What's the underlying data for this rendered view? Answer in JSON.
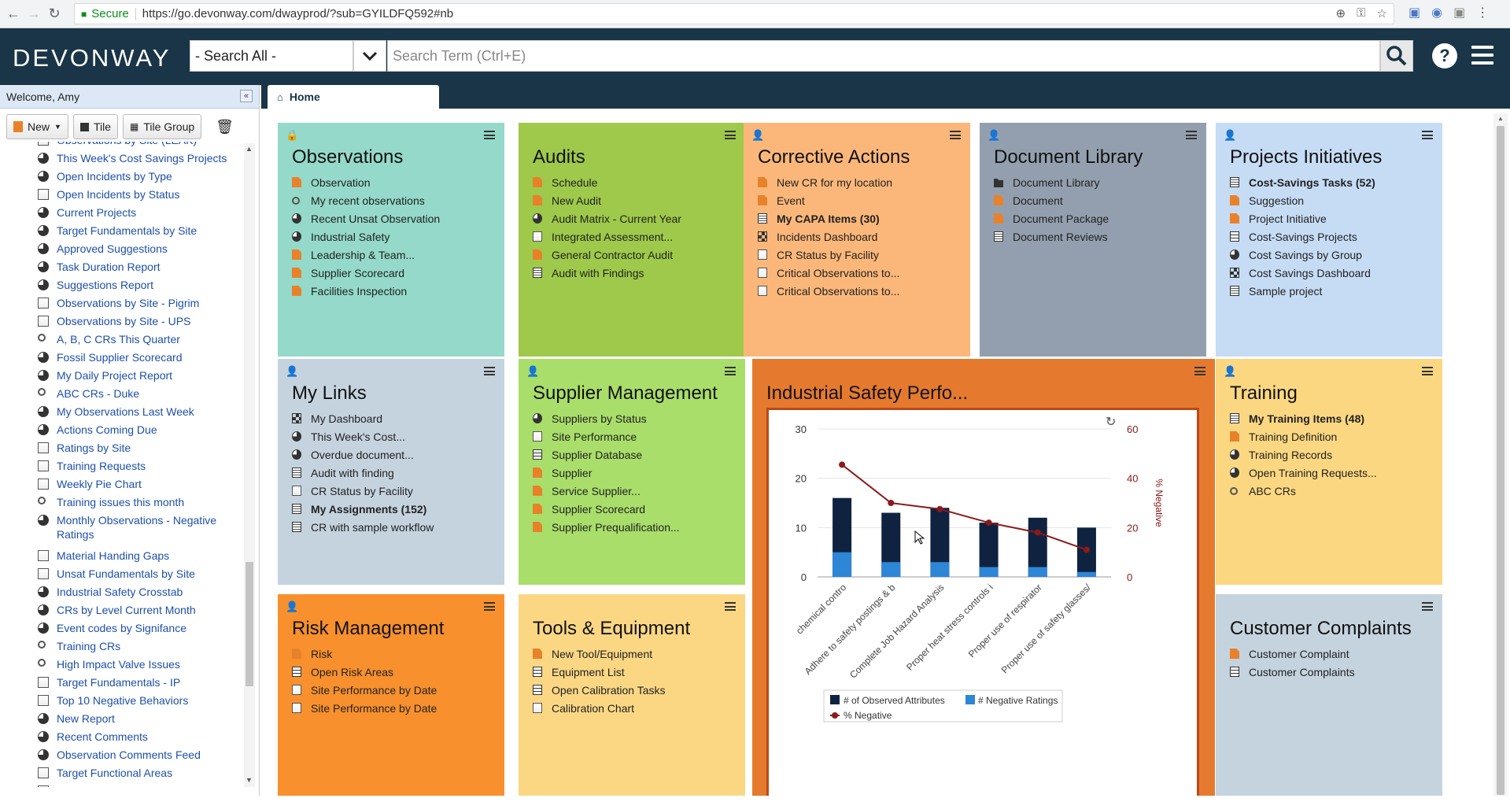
{
  "browser": {
    "secure_label": "Secure",
    "url": "https://go.devonway.com/dwayprod/?sub=GYILDFQ592#nb"
  },
  "header": {
    "logo": "DEVONWAY",
    "search_scope": "- Search All -",
    "search_placeholder": "Search Term (Ctrl+E)",
    "help": "?"
  },
  "sidebar": {
    "welcome": "Welcome, Amy",
    "tools": {
      "new": "New",
      "tile": "Tile",
      "tile_group": "Tile Group"
    },
    "items": [
      {
        "label": "Observations by Site (LEAK)",
        "icon": "chart"
      },
      {
        "label": "This Week's Cost Savings Projects",
        "icon": "pie"
      },
      {
        "label": "Open Incidents by Type",
        "icon": "pie"
      },
      {
        "label": "Open Incidents by Status",
        "icon": "chart"
      },
      {
        "label": "Current Projects",
        "icon": "pie"
      },
      {
        "label": "Target Fundamentals by Site",
        "icon": "pie"
      },
      {
        "label": "Approved Suggestions",
        "icon": "pie"
      },
      {
        "label": "Task Duration Report",
        "icon": "pie"
      },
      {
        "label": "Suggestions Report",
        "icon": "pie"
      },
      {
        "label": "Observations by Site - Pigrim",
        "icon": "chart"
      },
      {
        "label": "Observations by Site - UPS",
        "icon": "chart"
      },
      {
        "label": "A, B, C CRs This Quarter",
        "icon": "search"
      },
      {
        "label": "Fossil Supplier Scorecard",
        "icon": "pie"
      },
      {
        "label": "My Daily Project Report",
        "icon": "pie"
      },
      {
        "label": "ABC CRs - Duke",
        "icon": "search"
      },
      {
        "label": "My Observations Last Week",
        "icon": "pie"
      },
      {
        "label": "Actions Coming Due",
        "icon": "pie"
      },
      {
        "label": "Ratings by Site",
        "icon": "chart"
      },
      {
        "label": "Training Requests",
        "icon": "chart"
      },
      {
        "label": "Weekly Pie Chart",
        "icon": "chart"
      },
      {
        "label": "Training issues this month",
        "icon": "search"
      },
      {
        "label": "Monthly Observations - Negative Ratings",
        "icon": "pie",
        "tall": true
      },
      {
        "label": "Material Handing Gaps",
        "icon": "chart"
      },
      {
        "label": "Unsat Fundamentals by Site",
        "icon": "chart"
      },
      {
        "label": "Industrial Safety Crosstab",
        "icon": "pie"
      },
      {
        "label": "CRs by Level Current Month",
        "icon": "pie"
      },
      {
        "label": "Event codes by Signifance",
        "icon": "pie"
      },
      {
        "label": "Training CRs",
        "icon": "search"
      },
      {
        "label": "High Impact Valve Issues",
        "icon": "search"
      },
      {
        "label": "Target Fundamentals - IP",
        "icon": "chart"
      },
      {
        "label": "Top 10 Negative Behaviors",
        "icon": "chart"
      },
      {
        "label": "New Report",
        "icon": "pie"
      },
      {
        "label": "Recent Comments",
        "icon": "pie"
      },
      {
        "label": "Observation Comments Feed",
        "icon": "pie"
      },
      {
        "label": "Target Functional Areas",
        "icon": "chart"
      },
      {
        "label": "Upcoming Audits",
        "icon": "chart"
      }
    ]
  },
  "tabs": {
    "home": "Home"
  },
  "tiles": {
    "observations": {
      "title": "Observations",
      "color": "#94d9c9",
      "links": [
        {
          "label": "Observation",
          "icon": "doc"
        },
        {
          "label": "My recent observations",
          "icon": "search"
        },
        {
          "label": "Recent Unsat Observation",
          "icon": "pie"
        },
        {
          "label": "Industrial Safety",
          "icon": "pie"
        },
        {
          "label": "Leadership & Team...",
          "icon": "doc"
        },
        {
          "label": "Supplier Scorecard",
          "icon": "doc"
        },
        {
          "label": "Facilities Inspection",
          "icon": "doc"
        }
      ]
    },
    "audits": {
      "title": "Audits",
      "color": "#9ec94a",
      "links": [
        {
          "label": "Schedule",
          "icon": "doc"
        },
        {
          "label": "New Audit",
          "icon": "doc"
        },
        {
          "label": "Audit Matrix - Current Year",
          "icon": "pie"
        },
        {
          "label": "Integrated Assessment...",
          "icon": "chart"
        },
        {
          "label": "General Contractor Audit",
          "icon": "doc"
        },
        {
          "label": "Audit with Findings",
          "icon": "list"
        }
      ]
    },
    "corrective": {
      "title": "Corrective Actions",
      "color": "#fbb77a",
      "links": [
        {
          "label": "New CR for my location",
          "icon": "doc"
        },
        {
          "label": "Event",
          "icon": "doc"
        },
        {
          "label": "My CAPA Items (30)",
          "icon": "list",
          "bold": true
        },
        {
          "label": "Incidents Dashboard",
          "icon": "dash"
        },
        {
          "label": "CR Status by Facility",
          "icon": "chart"
        },
        {
          "label": "Critical Observations to...",
          "icon": "chart"
        },
        {
          "label": "Critical Observations to...",
          "icon": "chart"
        }
      ]
    },
    "doclib": {
      "title": "Document Library",
      "color": "#939fae",
      "links": [
        {
          "label": "Document Library",
          "icon": "folder"
        },
        {
          "label": "Document",
          "icon": "doc"
        },
        {
          "label": "Document Package",
          "icon": "doc"
        },
        {
          "label": "Document Reviews",
          "icon": "list"
        }
      ]
    },
    "projects": {
      "title": "Projects Initiatives",
      "color": "#c6dcf5",
      "links": [
        {
          "label": "Cost-Savings Tasks (52)",
          "icon": "list",
          "bold": true
        },
        {
          "label": "Suggestion",
          "icon": "doc"
        },
        {
          "label": "Project Initiative",
          "icon": "doc"
        },
        {
          "label": "Cost-Savings Projects",
          "icon": "grid"
        },
        {
          "label": "Cost Savings by Group",
          "icon": "pie"
        },
        {
          "label": "Cost Savings Dashboard",
          "icon": "dash"
        },
        {
          "label": "Sample project",
          "icon": "list"
        }
      ]
    },
    "mylinks": {
      "title": "My Links",
      "color": "#c5d3df",
      "links": [
        {
          "label": "My Dashboard",
          "icon": "dash"
        },
        {
          "label": "This Week's Cost...",
          "icon": "pie"
        },
        {
          "label": "Overdue document...",
          "icon": "pie"
        },
        {
          "label": "Audit with finding",
          "icon": "list"
        },
        {
          "label": "CR Status by Facility",
          "icon": "chart"
        },
        {
          "label": "My Assignments (152)",
          "icon": "list",
          "bold": true
        },
        {
          "label": "CR with sample workflow",
          "icon": "list"
        }
      ]
    },
    "supplier": {
      "title": "Supplier Management",
      "color": "#a9de6a",
      "links": [
        {
          "label": "Suppliers by Status",
          "icon": "pie"
        },
        {
          "label": "Site Performance",
          "icon": "chart"
        },
        {
          "label": "Supplier Database",
          "icon": "grid"
        },
        {
          "label": "Supplier",
          "icon": "doc"
        },
        {
          "label": "Service Supplier...",
          "icon": "doc"
        },
        {
          "label": "Supplier Scorecard",
          "icon": "doc"
        },
        {
          "label": "Supplier Prequalification...",
          "icon": "doc"
        }
      ]
    },
    "training": {
      "title": "Training",
      "color": "#fcd781",
      "links": [
        {
          "label": "My Training Items (48)",
          "icon": "list",
          "bold": true
        },
        {
          "label": "Training Definition",
          "icon": "doc"
        },
        {
          "label": "Training Records",
          "icon": "pie"
        },
        {
          "label": "Open Training Requests...",
          "icon": "pie"
        },
        {
          "label": "ABC CRs",
          "icon": "search"
        }
      ]
    },
    "risk": {
      "title": "Risk Management",
      "color": "#f7902d",
      "links": [
        {
          "label": "Risk",
          "icon": "doc"
        },
        {
          "label": "Open Risk Areas",
          "icon": "grid"
        },
        {
          "label": "Site Performance by Date",
          "icon": "chart"
        },
        {
          "label": "Site Performance by Date",
          "icon": "chart"
        }
      ]
    },
    "tools": {
      "title": "Tools & Equipment",
      "color": "#fbd784",
      "links": [
        {
          "label": "New Tool/Equipment",
          "icon": "doc"
        },
        {
          "label": "Equipment List",
          "icon": "grid"
        },
        {
          "label": "Open Calibration Tasks",
          "icon": "grid"
        },
        {
          "label": "Calibration Chart",
          "icon": "chart"
        }
      ]
    },
    "complaints": {
      "title": "Customer Complaints",
      "color": "#c5d3df",
      "links": [
        {
          "label": "Customer Complaint",
          "icon": "doc"
        },
        {
          "label": "Customer Complaints",
          "icon": "grid"
        }
      ]
    }
  },
  "chart_tile": {
    "title": "Industrial Safety Perfo...",
    "color": "#e57a2e"
  },
  "chart_data": {
    "type": "bar",
    "categories": [
      "chemical contro",
      "Adhere to safety postings & b",
      "Complete Job Hazard Analysis",
      "Proper heat stress controls i",
      "Proper use of respirator",
      "Proper use of safety glasses/"
    ],
    "series": [
      {
        "name": "# of Observed Attributes",
        "type": "bar-stacked",
        "color": "#0f2340",
        "values": [
          11,
          10,
          11,
          9,
          10,
          9
        ]
      },
      {
        "name": "# Negative Ratings",
        "type": "bar-stacked",
        "color": "#2e86d6",
        "values": [
          5,
          3,
          3,
          2,
          2,
          1
        ]
      },
      {
        "name": "% Negative",
        "type": "line",
        "axis": "right",
        "color": "#8b1a1a",
        "values": [
          45.5,
          30,
          27.5,
          22,
          18,
          11
        ]
      }
    ],
    "ylim": [
      0,
      30
    ],
    "yticks": [
      "0",
      "10",
      "20",
      "30"
    ],
    "y2lim": [
      0,
      60
    ],
    "y2ticks": [
      "0",
      "20",
      "40",
      "60"
    ],
    "y2label": "% Negative",
    "legend_position": "bottom"
  }
}
